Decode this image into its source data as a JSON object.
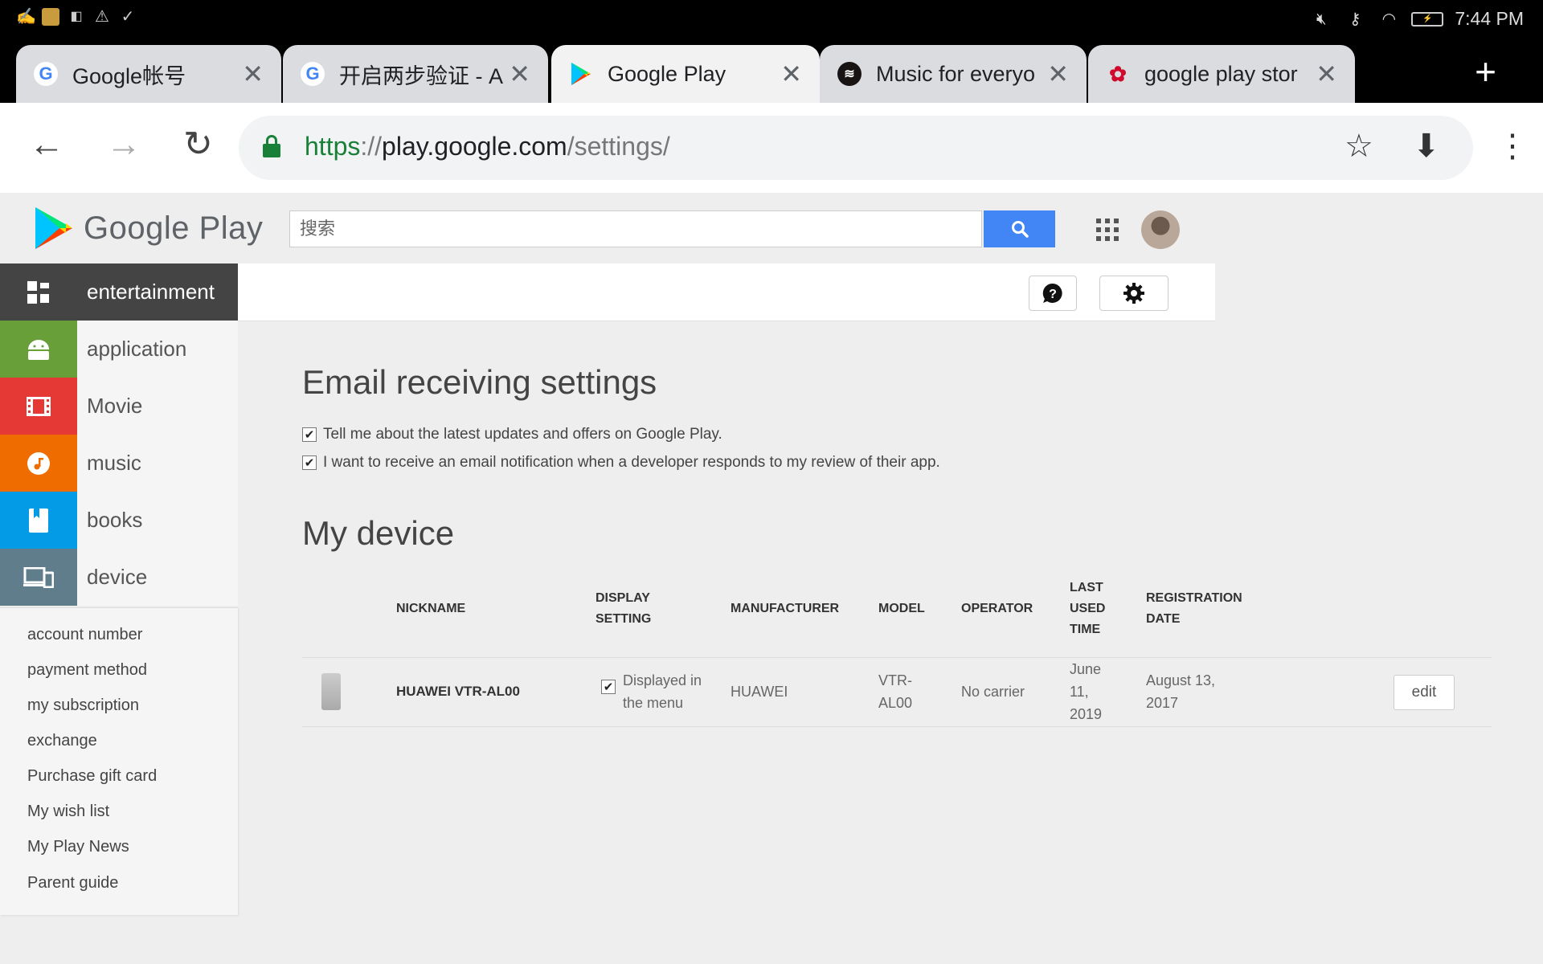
{
  "status_bar": {
    "left_icons": [
      "sign-icon",
      "photo-icon",
      "outlook-icon",
      "warning-icon",
      "download-done-icon"
    ],
    "time": "7:44 PM"
  },
  "tabs": [
    {
      "title": "Google帐号",
      "favicon": "G",
      "active": false
    },
    {
      "title": "开启两步验证 - A",
      "favicon": "G",
      "active": false
    },
    {
      "title": "Google Play",
      "favicon": "play",
      "active": true
    },
    {
      "title": "Music for everyo",
      "favicon": "spotify",
      "active": false
    },
    {
      "title": "google play stor",
      "favicon": "huawei",
      "active": false
    }
  ],
  "address": {
    "scheme": "https",
    "sep": "://",
    "host": "play.google.com",
    "path": "/settings/"
  },
  "play": {
    "brand": "Google Play",
    "search_placeholder": "搜索"
  },
  "nav": [
    {
      "label": "entertainment",
      "color": "#444444",
      "icon": "apps-icon"
    },
    {
      "label": "application",
      "color": "#689f38",
      "icon": "android-icon"
    },
    {
      "label": "Movie",
      "color": "#e53935",
      "icon": "film-icon"
    },
    {
      "label": "music",
      "color": "#ef6c00",
      "icon": "music-icon"
    },
    {
      "label": "books",
      "color": "#039be5",
      "icon": "book-icon"
    },
    {
      "label": "device",
      "color": "#607d8b",
      "icon": "devices-icon"
    }
  ],
  "submenu": [
    "account number",
    "payment method",
    "my subscription",
    "exchange",
    "Purchase gift card",
    "My wish list",
    "My Play News",
    "Parent guide"
  ],
  "email_settings": {
    "title": "Email receiving settings",
    "options": [
      {
        "label": "Tell me about the latest updates and offers on Google Play.",
        "checked": true
      },
      {
        "label": "I want to receive an email notification when a developer responds to my review of their app.",
        "checked": true
      }
    ]
  },
  "devices": {
    "title": "My device",
    "headers": {
      "nickname": "NICKNAME",
      "display1": "DISPLAY",
      "display2": "SETTING",
      "manufacturer": "MANUFACTURER",
      "model": "MODEL",
      "operator": "OPERATOR",
      "last1": "LAST",
      "last2": "USED",
      "last3": "TIME",
      "reg1": "REGISTRATION",
      "reg2": "DATE"
    },
    "row": {
      "nickname": "HUAWEI VTR-AL00",
      "display1": "Displayed in",
      "display2": "the menu",
      "manufacturer": "HUAWEI",
      "model1": "VTR-",
      "model2": "AL00",
      "operator": "No carrier",
      "last1": "June",
      "last2": "11,",
      "last3": "2019",
      "reg1": "August 13,",
      "reg2": "2017",
      "edit": "edit"
    }
  }
}
